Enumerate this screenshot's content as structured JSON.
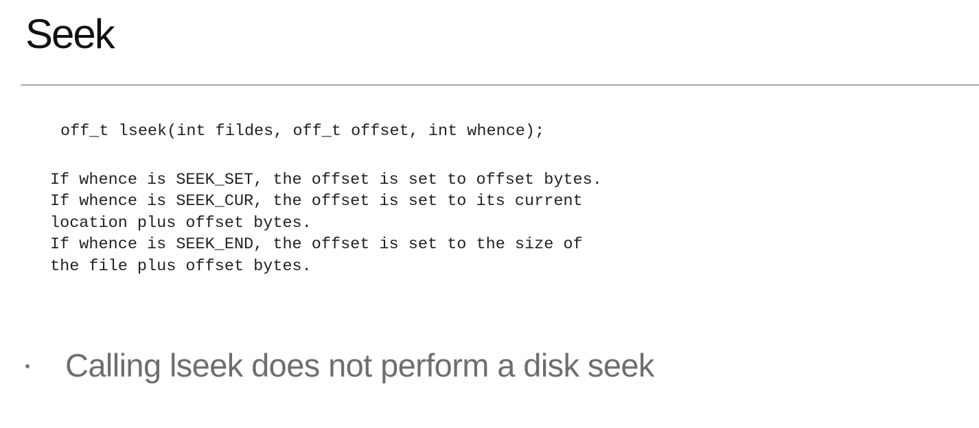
{
  "slide": {
    "title": "Seek",
    "code": {
      "signature": "off_t lseek(int fildes, off_t offset, int whence);",
      "lines": [
        "If whence is SEEK_SET, the offset is set to offset bytes.",
        "If whence is SEEK_CUR, the offset is set to its current",
        "location plus offset bytes.",
        "If whence is SEEK_END, the offset is set to the size of",
        "the file plus offset bytes."
      ]
    },
    "bullets": [
      "Calling lseek does not perform a disk seek"
    ],
    "colors": {
      "title": "#111111",
      "rule": "#a9a9a9",
      "code": "#222222",
      "bullet_text": "#6e6e6e"
    }
  }
}
